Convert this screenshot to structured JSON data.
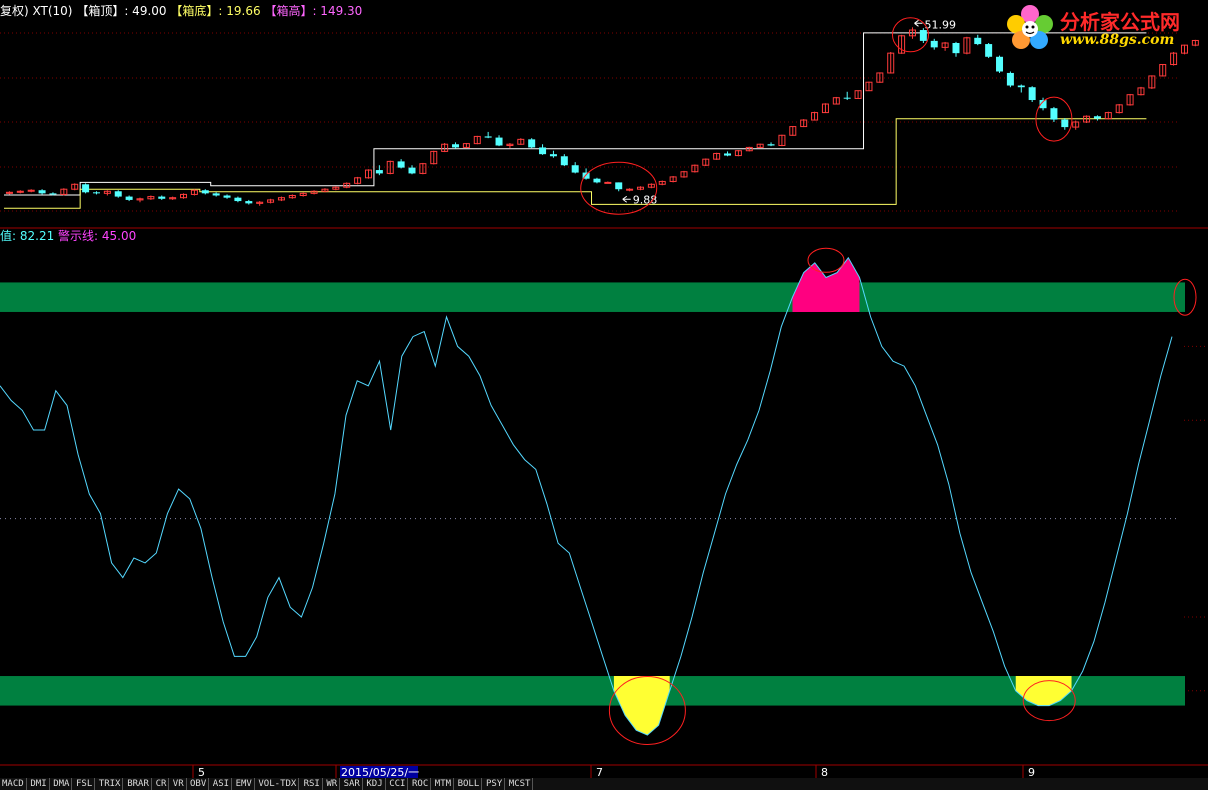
{
  "header_main": {
    "prefix": "复权) XT(10)",
    "box_top_label": "【箱顶】",
    "box_top_value": ": 49.00",
    "box_bottom_label": "【箱底】",
    "box_bottom_value": ": 19.66",
    "box_high_label": "【箱高】",
    "box_high_value": ": 149.30"
  },
  "header_indicator": {
    "value_label": "值: 82.21",
    "warning_label": "警示线: 45.00"
  },
  "logo": {
    "name": "分析家公式网",
    "url": "www.88gs.com"
  },
  "price_annotations": {
    "high": "51.99",
    "low": "9.88"
  },
  "x_axis": {
    "labels": [
      "5",
      "2015/05/25/一",
      "7",
      "8",
      "9"
    ]
  },
  "tabs": [
    "MACD",
    "DMI",
    "DMA",
    "FSL",
    "TRIX",
    "BRAR",
    "CR",
    "VR",
    "OBV",
    "ASI",
    "EMV",
    "VOL-TDX",
    "RSI",
    "WR",
    "SAR",
    "KDJ",
    "CCI",
    "ROC",
    "MTM",
    "BOLL",
    "PSY",
    "MCST"
  ],
  "colors": {
    "background": "#000000",
    "up_candle": "#ff3c3c",
    "down_candle": "#54ffff",
    "box_top_line": "#ffffff",
    "box_bottom_line": "#ffff66",
    "indicator_line": "#54d8ff",
    "band": "#008040",
    "overbought_fill": "#ff0080",
    "oversold_fill": "#ffff33",
    "circle": "#ff2020",
    "header_text": "#ffffff",
    "header_label_top": "#ffffff",
    "header_label_bottom": "#ffff66",
    "header_label_high": "#ff66ff",
    "indicator_value_text": "#54ffff",
    "warning_text": "#ff44ff",
    "selected_date_bg": "#0000a0"
  },
  "chart_data": [
    {
      "type": "candlestick",
      "title": "",
      "candles_ohlc": [
        [
          8.9,
          9.1,
          8.8,
          9.0
        ],
        [
          9.0,
          9.2,
          8.9,
          9.1
        ],
        [
          9.1,
          9.3,
          9.0,
          9.2
        ],
        [
          9.2,
          9.3,
          8.8,
          8.9
        ],
        [
          8.9,
          9.0,
          8.7,
          8.8
        ],
        [
          8.8,
          9.4,
          8.7,
          9.3
        ],
        [
          9.3,
          9.9,
          9.2,
          9.8
        ],
        [
          9.8,
          9.9,
          8.9,
          9.0
        ],
        [
          9.0,
          9.1,
          8.8,
          8.9
        ],
        [
          8.9,
          9.2,
          8.7,
          9.1
        ],
        [
          9.1,
          9.2,
          8.5,
          8.6
        ],
        [
          8.6,
          8.7,
          8.2,
          8.3
        ],
        [
          8.3,
          8.5,
          8.1,
          8.4
        ],
        [
          8.4,
          8.7,
          8.3,
          8.6
        ],
        [
          8.6,
          8.7,
          8.3,
          8.4
        ],
        [
          8.4,
          8.6,
          8.3,
          8.5
        ],
        [
          8.5,
          8.9,
          8.4,
          8.8
        ],
        [
          8.8,
          9.3,
          8.7,
          9.2
        ],
        [
          9.2,
          9.3,
          8.8,
          8.9
        ],
        [
          8.9,
          9.0,
          8.6,
          8.7
        ],
        [
          8.7,
          8.8,
          8.4,
          8.5
        ],
        [
          8.5,
          8.6,
          8.1,
          8.2
        ],
        [
          8.2,
          8.3,
          7.9,
          8.0
        ],
        [
          8.0,
          8.2,
          7.8,
          8.1
        ],
        [
          8.1,
          8.4,
          8.0,
          8.3
        ],
        [
          8.3,
          8.6,
          8.2,
          8.5
        ],
        [
          8.5,
          8.8,
          8.4,
          8.7
        ],
        [
          8.7,
          9.0,
          8.6,
          8.9
        ],
        [
          8.9,
          9.2,
          8.8,
          9.1
        ],
        [
          9.1,
          9.4,
          9.0,
          9.3
        ],
        [
          9.3,
          9.6,
          9.2,
          9.5
        ],
        [
          9.5,
          10.0,
          9.4,
          9.9
        ],
        [
          9.9,
          10.6,
          9.8,
          10.5
        ],
        [
          10.5,
          11.5,
          10.4,
          11.4
        ],
        [
          11.4,
          12.0,
          10.8,
          11.0
        ],
        [
          11.0,
          12.6,
          10.9,
          12.5
        ],
        [
          12.5,
          12.8,
          11.6,
          11.7
        ],
        [
          11.7,
          12.0,
          10.9,
          11.0
        ],
        [
          11.0,
          12.3,
          10.9,
          12.2
        ],
        [
          12.2,
          14.0,
          12.1,
          13.9
        ],
        [
          13.9,
          15.2,
          13.8,
          15.0
        ],
        [
          15.0,
          15.3,
          14.3,
          14.5
        ],
        [
          14.5,
          15.2,
          14.4,
          15.1
        ],
        [
          15.1,
          16.4,
          15.0,
          16.3
        ],
        [
          16.3,
          17.1,
          16.0,
          16.1
        ],
        [
          16.1,
          16.5,
          14.7,
          14.8
        ],
        [
          14.8,
          15.2,
          14.4,
          15.0
        ],
        [
          15.0,
          16.0,
          14.9,
          15.8
        ],
        [
          15.8,
          16.0,
          14.4,
          14.5
        ],
        [
          14.5,
          15.0,
          13.4,
          13.5
        ],
        [
          13.5,
          14.0,
          13.0,
          13.2
        ],
        [
          13.2,
          13.5,
          11.9,
          12.0
        ],
        [
          12.0,
          12.4,
          11.0,
          11.1
        ],
        [
          11.1,
          11.6,
          10.3,
          10.4
        ],
        [
          10.4,
          10.5,
          9.9,
          10.0
        ],
        [
          10.0,
          10.1,
          9.9,
          10.0
        ],
        [
          10.0,
          10.0,
          9.1,
          9.3
        ],
        [
          9.3,
          9.4,
          9.1,
          9.3
        ],
        [
          9.3,
          9.6,
          9.2,
          9.5
        ],
        [
          9.5,
          9.9,
          9.4,
          9.8
        ],
        [
          9.8,
          10.2,
          9.7,
          10.1
        ],
        [
          10.1,
          10.7,
          10.0,
          10.6
        ],
        [
          10.6,
          11.3,
          10.5,
          11.2
        ],
        [
          11.2,
          12.1,
          11.1,
          12.0
        ],
        [
          12.0,
          12.9,
          11.9,
          12.8
        ],
        [
          12.8,
          13.7,
          12.7,
          13.6
        ],
        [
          13.6,
          13.9,
          13.2,
          13.3
        ],
        [
          13.3,
          14.1,
          13.2,
          14.0
        ],
        [
          14.0,
          14.6,
          13.9,
          14.5
        ],
        [
          14.5,
          15.1,
          14.4,
          15.0
        ],
        [
          15.0,
          15.3,
          14.7,
          14.8
        ],
        [
          14.8,
          16.6,
          14.7,
          16.5
        ],
        [
          16.5,
          18.2,
          16.4,
          18.1
        ],
        [
          18.1,
          19.6,
          18.0,
          19.4
        ],
        [
          19.4,
          21.2,
          19.3,
          21.0
        ],
        [
          21.0,
          23.2,
          20.9,
          23.0
        ],
        [
          23.0,
          24.8,
          22.9,
          24.6
        ],
        [
          24.6,
          26.2,
          24.0,
          24.4
        ],
        [
          24.4,
          26.6,
          24.3,
          26.5
        ],
        [
          26.5,
          29.2,
          26.4,
          29.0
        ],
        [
          29.0,
          32.2,
          28.8,
          32.0
        ],
        [
          32.0,
          40.0,
          31.8,
          39.5
        ],
        [
          39.5,
          48.0,
          39.2,
          47.5
        ],
        [
          47.5,
          51.99,
          46.0,
          50.5
        ],
        [
          50.5,
          51.5,
          44.0,
          45.0
        ],
        [
          45.0,
          46.0,
          41.0,
          42.0
        ],
        [
          42.0,
          44.5,
          40.5,
          44.0
        ],
        [
          44.0,
          44.5,
          38.0,
          39.5
        ],
        [
          39.5,
          47.0,
          39.0,
          46.5
        ],
        [
          46.5,
          48.0,
          43.0,
          43.5
        ],
        [
          43.5,
          44.0,
          37.5,
          38.0
        ],
        [
          38.0,
          38.5,
          32.0,
          32.5
        ],
        [
          32.0,
          32.5,
          27.5,
          28.0
        ],
        [
          28.0,
          28.3,
          26.0,
          27.5
        ],
        [
          27.5,
          27.8,
          23.5,
          24.0
        ],
        [
          24.0,
          24.6,
          21.5,
          22.0
        ],
        [
          22.0,
          22.3,
          19.0,
          19.5
        ],
        [
          19.5,
          19.8,
          17.5,
          18.0
        ],
        [
          18.0,
          19.3,
          17.5,
          19.0
        ],
        [
          19.0,
          20.4,
          18.8,
          20.2
        ],
        [
          20.2,
          20.4,
          19.3,
          19.7
        ],
        [
          19.7,
          21.2,
          19.5,
          21.0
        ],
        [
          21.0,
          23.0,
          20.8,
          22.8
        ],
        [
          22.8,
          25.6,
          22.6,
          25.4
        ],
        [
          25.4,
          27.6,
          25.2,
          27.3
        ],
        [
          27.3,
          31.2,
          27.0,
          31.0
        ],
        [
          31.0,
          35.2,
          30.8,
          35.0
        ],
        [
          35.0,
          40.0,
          34.6,
          39.5
        ],
        [
          39.5,
          43.2,
          39.0,
          43.0
        ],
        [
          43.0,
          45.5,
          42.5,
          45.2
        ]
      ],
      "box_top_steps": [
        [
          0,
          7,
          8.75
        ],
        [
          7,
          19,
          10.0
        ],
        [
          19,
          31,
          9.65
        ],
        [
          31,
          34,
          9.65
        ],
        [
          34,
          36,
          14.3
        ],
        [
          36,
          43,
          14.3
        ],
        [
          43,
          60,
          14.3
        ],
        [
          60,
          79,
          14.3
        ],
        [
          79,
          83,
          49.0
        ],
        [
          83,
          105,
          49.0
        ]
      ],
      "box_bottom_steps": [
        [
          0,
          7,
          7.6
        ],
        [
          7,
          18,
          9.3
        ],
        [
          18,
          34,
          9.05
        ],
        [
          34,
          44,
          9.05
        ],
        [
          44,
          54,
          9.05
        ],
        [
          54,
          82,
          7.92
        ],
        [
          82,
          105,
          19.66
        ]
      ],
      "annotations": [
        "51.99 (high)",
        "9.88 (low)"
      ]
    },
    {
      "type": "line",
      "title": "",
      "ylim": [
        0,
        100
      ],
      "warning_line": 45.0,
      "current_value": 82.21,
      "bands": [
        {
          "range": [
            87,
            93
          ]
        },
        {
          "range": [
            7,
            13
          ]
        }
      ],
      "values": [
        72,
        69,
        67,
        63,
        63,
        71,
        68,
        58,
        50,
        46,
        36,
        33,
        37,
        36,
        38,
        46,
        51,
        49,
        43,
        33,
        24,
        17,
        17,
        21,
        29,
        33,
        27,
        25,
        31,
        40,
        50,
        66,
        73,
        72,
        77,
        63,
        78,
        82,
        83,
        76,
        86,
        80,
        78,
        74,
        68,
        64,
        60,
        57,
        55,
        48,
        40,
        38,
        31,
        24,
        17,
        10,
        5,
        2,
        1,
        3,
        10,
        17,
        25,
        34,
        42,
        50,
        56,
        61,
        67,
        75,
        84,
        90,
        95,
        97,
        94,
        95,
        98,
        94,
        86,
        80,
        77,
        76,
        72,
        66,
        60,
        52,
        42,
        34,
        28,
        22,
        15,
        10,
        8,
        7,
        7,
        8,
        10,
        14,
        20,
        28,
        37,
        46,
        56,
        65,
        74,
        82
      ]
    }
  ]
}
